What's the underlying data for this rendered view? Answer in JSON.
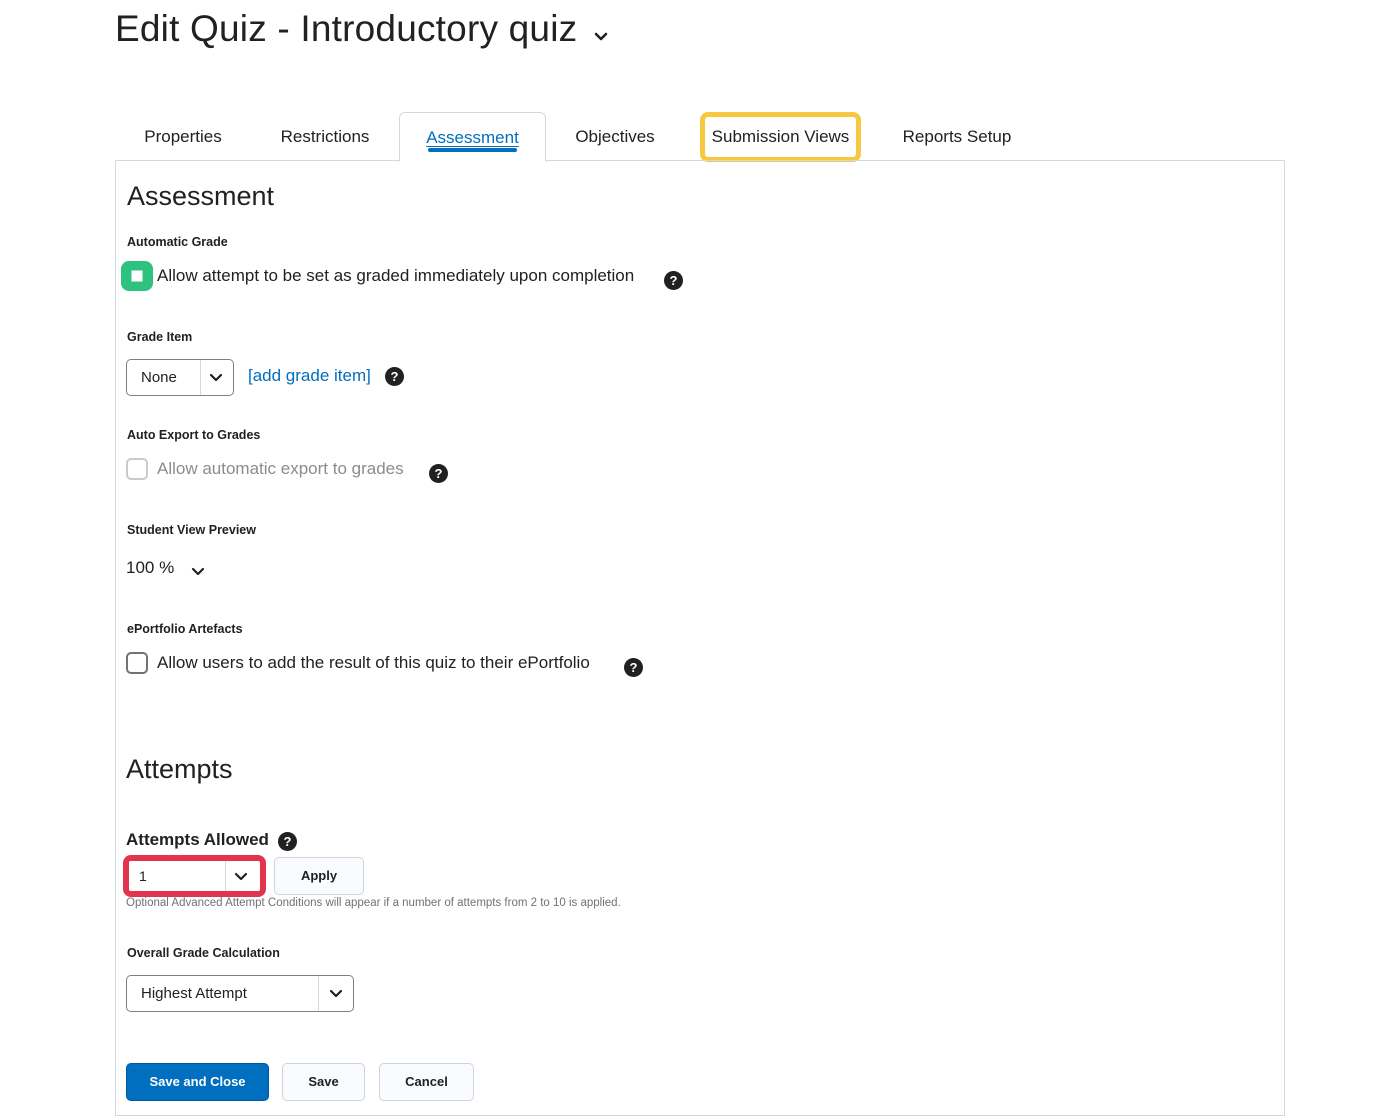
{
  "page": {
    "title": "Edit Quiz - Introductory quiz",
    "title_menu_icon": "chevron-down-icon"
  },
  "tabs": [
    {
      "label": "Properties",
      "active": false
    },
    {
      "label": "Restrictions",
      "active": false
    },
    {
      "label": "Assessment",
      "active": true
    },
    {
      "label": "Objectives",
      "active": false
    },
    {
      "label": "Submission Views",
      "active": false,
      "highlighted": true
    },
    {
      "label": "Reports Setup",
      "active": false
    }
  ],
  "assessment": {
    "heading": "Assessment",
    "automatic_grade": {
      "label": "Automatic Grade",
      "option": "Allow attempt to be set as graded immediately upon completion",
      "checked": false,
      "highlight_color": "#2ec27e"
    },
    "grade_item": {
      "label": "Grade Item",
      "selected": "None",
      "add_link": "[add grade item]"
    },
    "auto_export": {
      "label": "Auto Export to Grades",
      "option": "Allow automatic export to grades",
      "disabled": true
    },
    "student_view_preview": {
      "label": "Student View Preview",
      "value": "100 %"
    },
    "eportfolio": {
      "label": "ePortfolio Artefacts",
      "option": "Allow users to add the result of this quiz to their ePortfolio",
      "checked": false
    }
  },
  "attempts": {
    "heading": "Attempts",
    "allowed_label": "Attempts Allowed",
    "allowed_value": "1",
    "apply_label": "Apply",
    "hint": "Optional Advanced Attempt Conditions will appear if a number of attempts from 2 to 10 is applied.",
    "overall_label": "Overall Grade Calculation",
    "overall_value": "Highest Attempt"
  },
  "buttons": {
    "save_close": "Save and Close",
    "save": "Save",
    "cancel": "Cancel"
  },
  "colors": {
    "accent": "#006fbf",
    "highlight_yellow": "#f6c842",
    "highlight_red": "#e2334f",
    "highlight_green": "#2ec27e"
  }
}
